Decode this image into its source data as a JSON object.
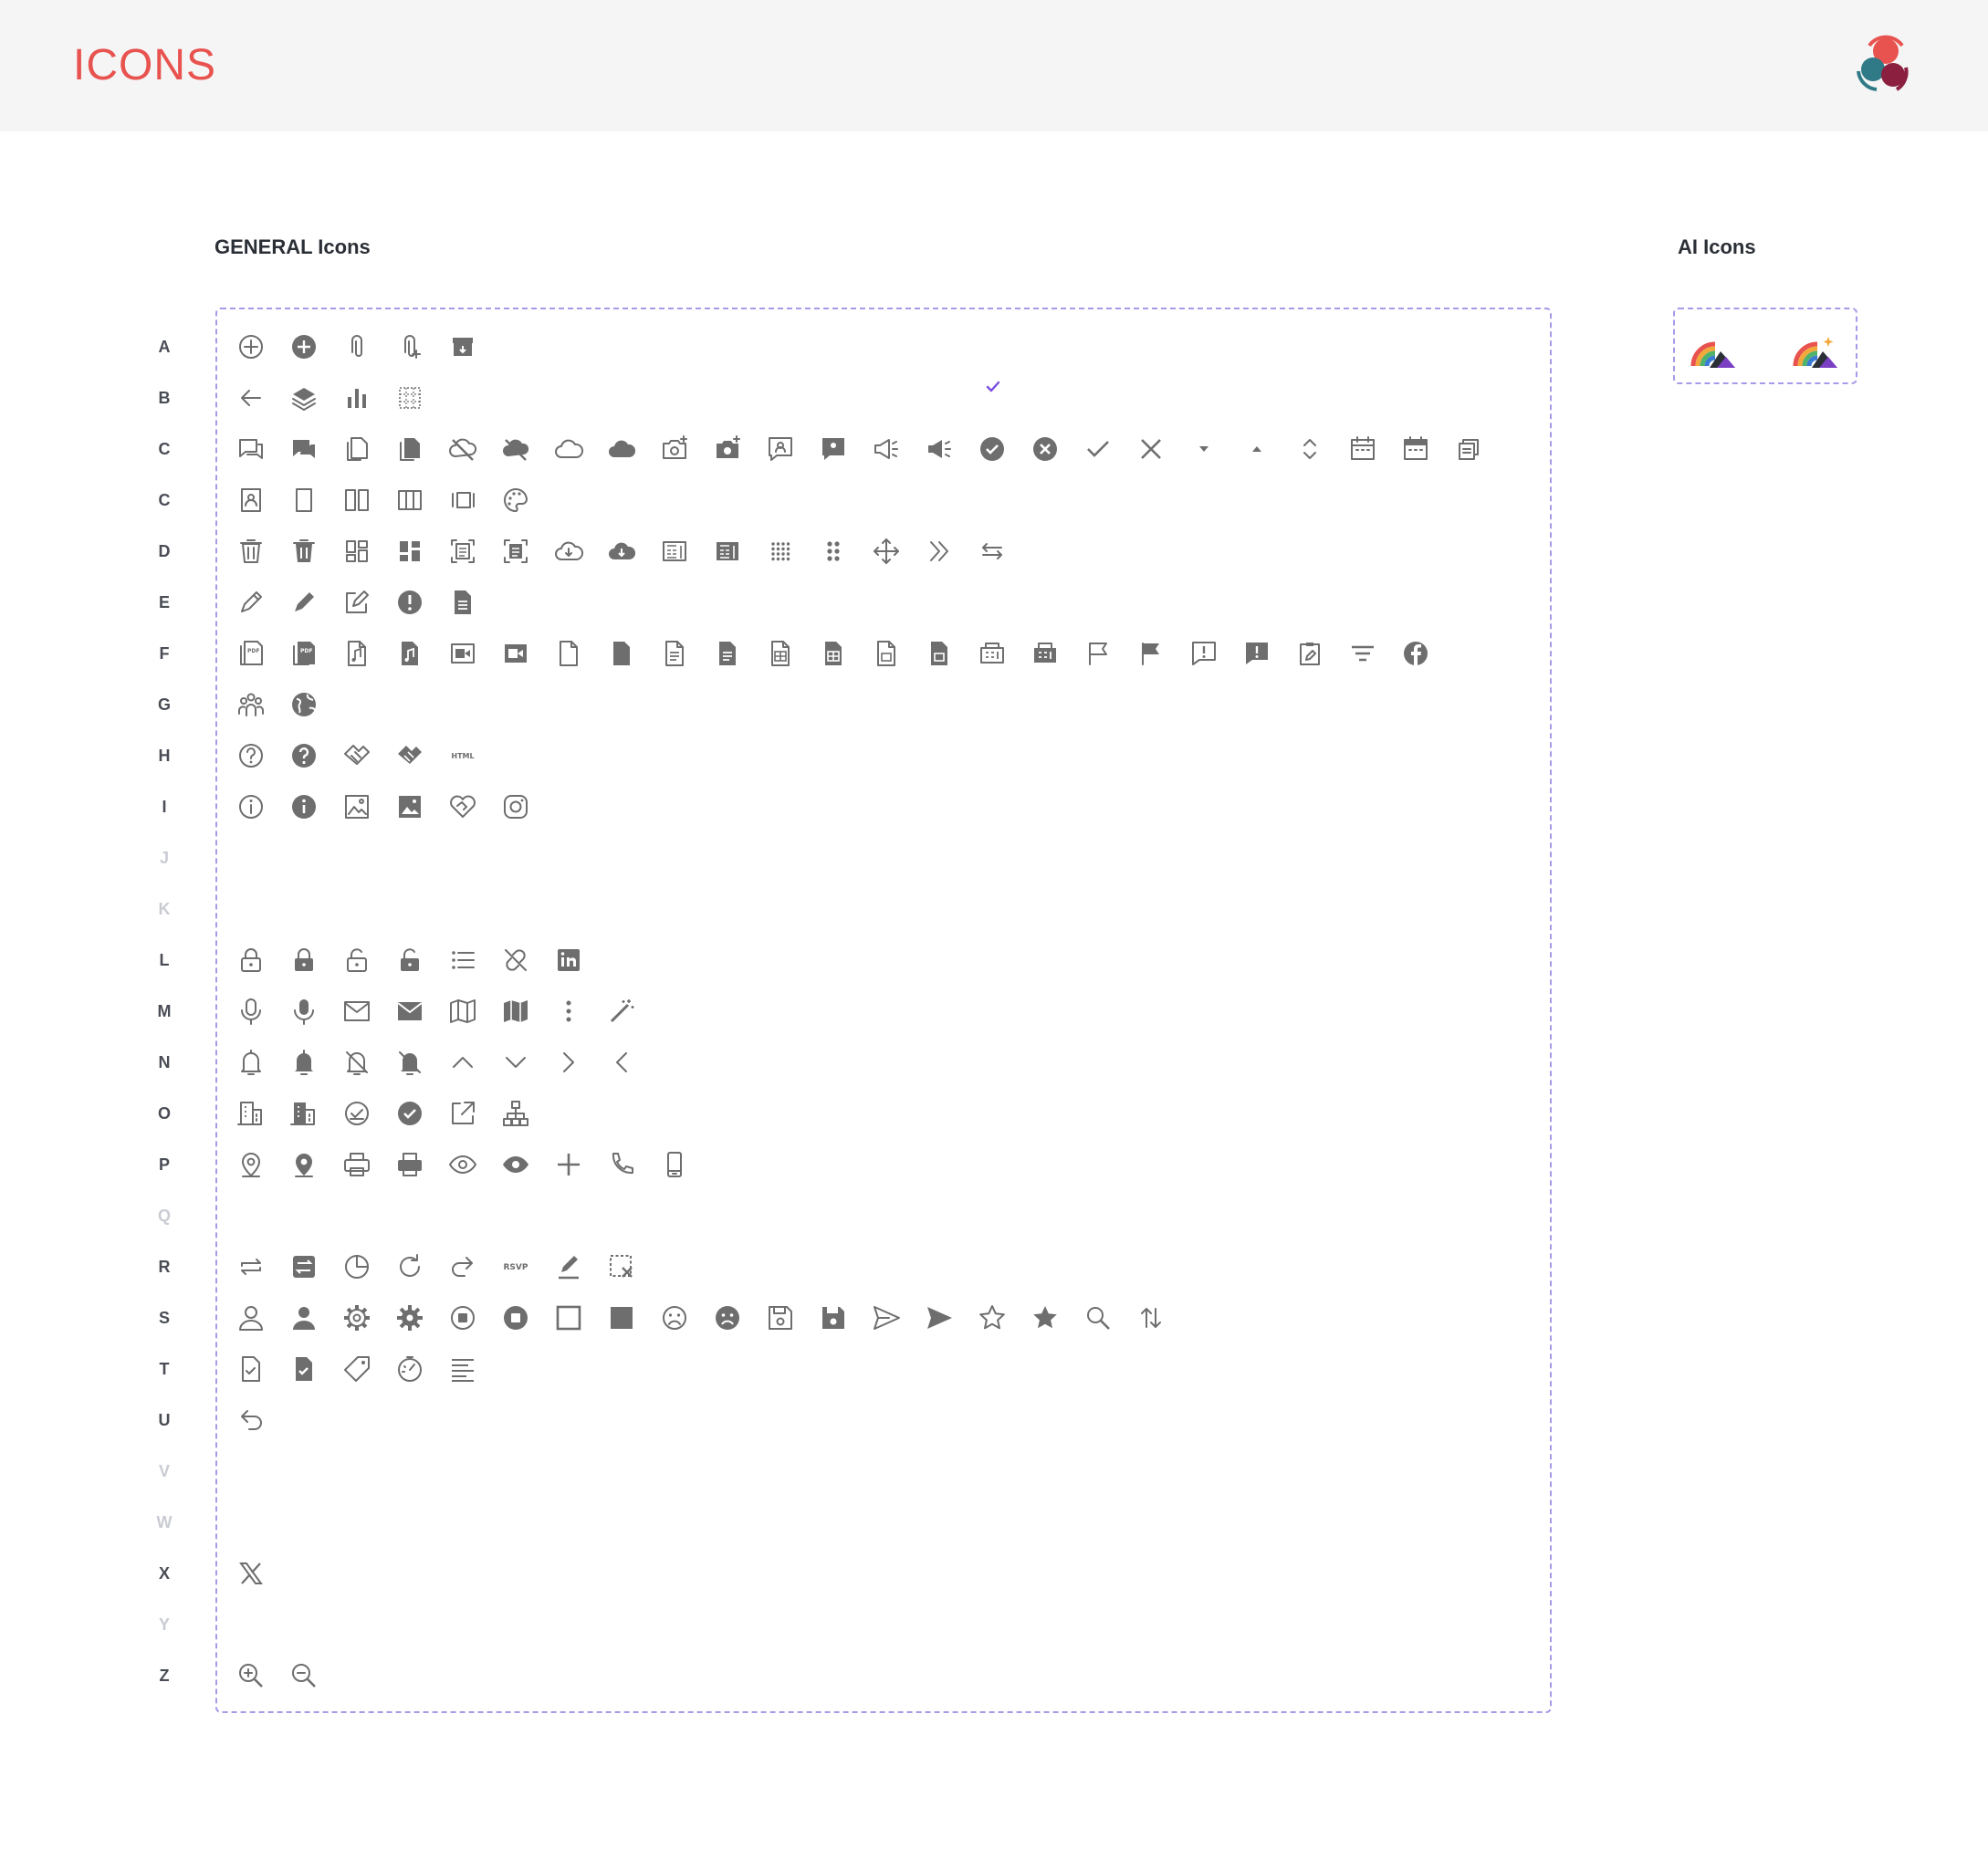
{
  "header": {
    "title": "ICONS"
  },
  "sections": {
    "general": {
      "title": "GENERAL Icons"
    },
    "ai": {
      "title": "AI Icons"
    }
  },
  "colors": {
    "accent": "#e8534f",
    "icon": "#6e6e6e",
    "border": "#a79ae8",
    "check": "#7b4de0"
  },
  "rows": [
    {
      "letter": "A",
      "dim": false,
      "icons": [
        "add-circle-outline-icon",
        "add-circle-filled-icon",
        "attachment-icon",
        "attachment-add-icon",
        "archive-icon"
      ]
    },
    {
      "letter": "B",
      "dim": false,
      "icons": [
        "arrow-back-icon",
        "layers-icon",
        "bar-chart-icon",
        "grid-dots-icon"
      ]
    },
    {
      "letter": "C",
      "dim": false,
      "icons": [
        "chat-outline-icon",
        "chat-filled-icon",
        "copy-outline-icon",
        "copy-filled-icon",
        "cloud-off-outline-icon",
        "cloud-off-filled-icon",
        "cloud-outline-icon",
        "cloud-filled-icon",
        "camera-add-outline-icon",
        "camera-add-filled-icon",
        "comment-user-outline-icon",
        "comment-user-filled-icon",
        "campaign-outline-icon",
        "campaign-filled-icon",
        "check-circle-filled-icon",
        "close-circle-filled-icon",
        "check-icon",
        "close-icon",
        "caret-down-icon",
        "caret-up-icon",
        "chevron-up-down-icon",
        "calendar-outline-icon",
        "calendar-filled-icon",
        "copy-stack-icon"
      ]
    },
    {
      "letter": "C",
      "dim": false,
      "icons": [
        "contact-card-icon",
        "column-single-icon",
        "columns-two-icon",
        "columns-three-icon",
        "carousel-icon",
        "palette-icon"
      ]
    },
    {
      "letter": "D",
      "dim": false,
      "icons": [
        "delete-outline-icon",
        "delete-filled-icon",
        "dashboard-outline-icon",
        "dashboard-filled-icon",
        "document-scan-outline-icon",
        "document-scan-filled-icon",
        "cloud-download-outline-icon",
        "cloud-download-filled-icon",
        "device-calculator-outline-icon",
        "device-calculator-filled-icon",
        "drag-grid-icon",
        "drag-handle-icon",
        "drag-move-icon",
        "double-chevron-right-icon",
        "swap-arrows-icon"
      ]
    },
    {
      "letter": "E",
      "dim": false,
      "icons": [
        "edit-outline-icon",
        "edit-filled-icon",
        "edit-square-icon",
        "error-filled-icon",
        "document-filled-icon"
      ]
    },
    {
      "letter": "F",
      "dim": false,
      "icons": [
        "file-pdf-outline-icon",
        "file-pdf-filled-icon",
        "file-music-outline-icon",
        "file-music-filled-icon",
        "file-video-outline-icon",
        "file-video-filled-icon",
        "file-blank-outline-icon",
        "file-blank-filled-icon",
        "file-text-outline-icon",
        "file-text-filled-icon",
        "file-table-outline-icon",
        "file-table-filled-icon",
        "file-image-outline-icon",
        "file-image-filled-icon",
        "fax-outline-icon",
        "fax-filled-icon",
        "flag-outline-icon",
        "flag-filled-icon",
        "feedback-outline-icon",
        "feedback-filled-icon",
        "form-edit-icon",
        "filter-icon",
        "facebook-icon"
      ]
    },
    {
      "letter": "G",
      "dim": false,
      "icons": [
        "group-icon",
        "globe-icon"
      ]
    },
    {
      "letter": "H",
      "dim": false,
      "icons": [
        "help-outline-icon",
        "help-filled-icon",
        "handshake-outline-icon",
        "handshake-filled-icon",
        "html-icon"
      ]
    },
    {
      "letter": "I",
      "dim": false,
      "icons": [
        "info-outline-icon",
        "info-filled-icon",
        "image-outline-icon",
        "image-filled-icon",
        "heart-handshake-icon",
        "instagram-icon"
      ]
    },
    {
      "letter": "J",
      "dim": true,
      "icons": []
    },
    {
      "letter": "K",
      "dim": true,
      "icons": []
    },
    {
      "letter": "L",
      "dim": false,
      "icons": [
        "lock-outline-icon",
        "lock-filled-icon",
        "lock-open-outline-icon",
        "lock-open-filled-icon",
        "list-icon",
        "link-off-icon",
        "linkedin-icon"
      ]
    },
    {
      "letter": "M",
      "dim": false,
      "icons": [
        "mic-outline-icon",
        "mic-filled-icon",
        "mail-outline-icon",
        "mail-filled-icon",
        "map-outline-icon",
        "map-filled-icon",
        "more-vertical-icon",
        "magic-wand-icon"
      ]
    },
    {
      "letter": "N",
      "dim": false,
      "icons": [
        "notification-outline-icon",
        "notification-filled-icon",
        "notification-off-outline-icon",
        "notification-off-filled-icon",
        "chevron-up-icon",
        "chevron-down-icon",
        "chevron-right-icon",
        "chevron-left-icon"
      ]
    },
    {
      "letter": "O",
      "dim": false,
      "icons": [
        "office-outline-icon",
        "office-filled-icon",
        "ok-circle-outline-icon",
        "ok-circle-filled-icon",
        "open-external-icon",
        "org-chart-icon"
      ]
    },
    {
      "letter": "P",
      "dim": false,
      "icons": [
        "pin-outline-icon",
        "pin-filled-icon",
        "print-outline-icon",
        "print-filled-icon",
        "preview-outline-icon",
        "preview-filled-icon",
        "plus-icon",
        "phone-icon",
        "phone-mobile-icon"
      ]
    },
    {
      "letter": "Q",
      "dim": true,
      "icons": []
    },
    {
      "letter": "R",
      "dim": false,
      "icons": [
        "repeat-icon",
        "replace-icon",
        "report-pie-icon",
        "refresh-icon",
        "redo-icon",
        "rsvp-icon",
        "rename-icon",
        "remove-selection-icon"
      ]
    },
    {
      "letter": "S",
      "dim": false,
      "icons": [
        "user-outline-icon",
        "user-filled-icon",
        "settings-outline-icon",
        "settings-filled-icon",
        "stop-circle-outline-icon",
        "stop-circle-filled-icon",
        "square-outline-icon",
        "square-filled-icon",
        "sad-outline-icon",
        "sad-filled-icon",
        "save-outline-icon",
        "save-filled-icon",
        "send-outline-icon",
        "send-filled-icon",
        "star-outline-icon",
        "star-filled-icon",
        "search-icon",
        "sort-icon"
      ]
    },
    {
      "letter": "T",
      "dim": false,
      "icons": [
        "task-outline-icon",
        "task-filled-icon",
        "tag-icon",
        "timer-icon",
        "text-align-icon"
      ]
    },
    {
      "letter": "U",
      "dim": false,
      "icons": [
        "undo-icon"
      ]
    },
    {
      "letter": "V",
      "dim": true,
      "icons": []
    },
    {
      "letter": "W",
      "dim": true,
      "icons": []
    },
    {
      "letter": "X",
      "dim": false,
      "icons": [
        "x-logo-icon"
      ]
    },
    {
      "letter": "Y",
      "dim": true,
      "icons": []
    },
    {
      "letter": "Z",
      "dim": false,
      "icons": [
        "zoom-in-icon",
        "zoom-out-icon"
      ]
    }
  ],
  "ai_icons": [
    "ai-rainbow-icon",
    "ai-rainbow-sparkle-icon"
  ]
}
